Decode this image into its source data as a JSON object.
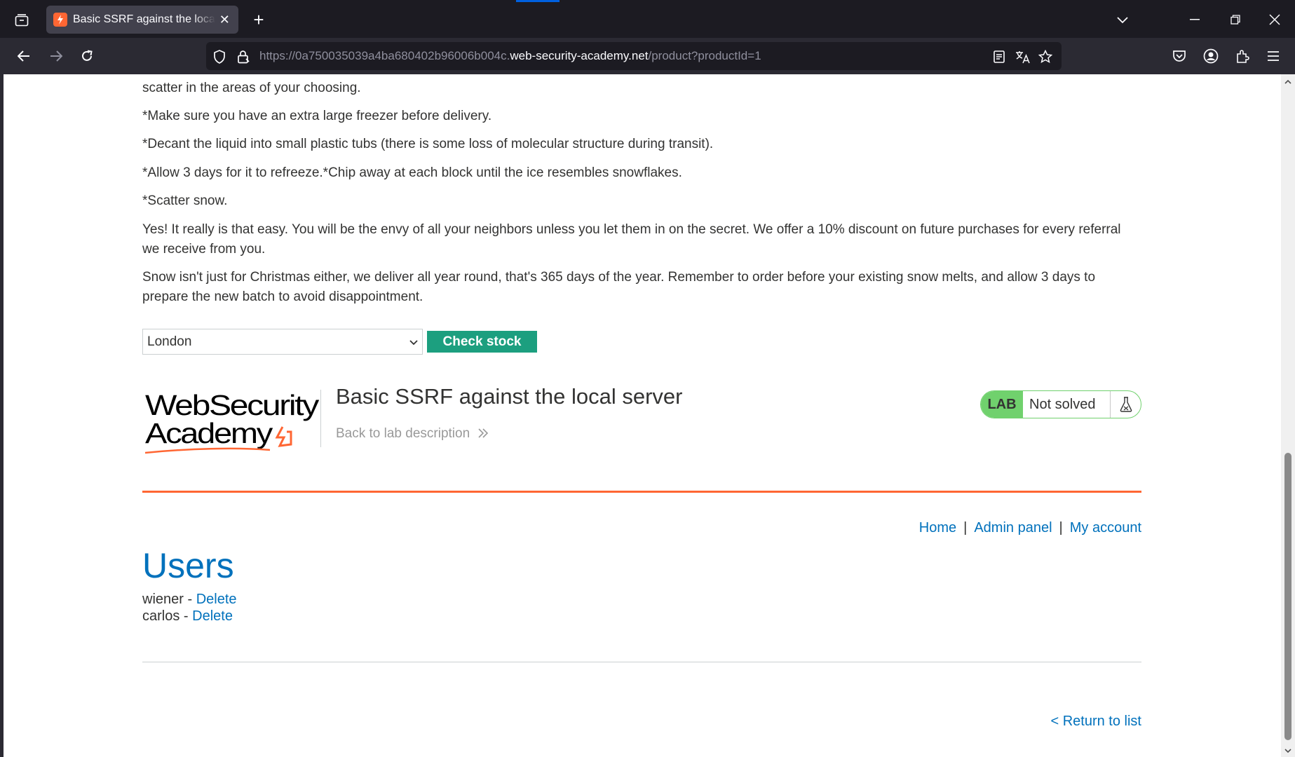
{
  "browser": {
    "tab": {
      "title": "Basic SSRF against the local server"
    },
    "url": {
      "prefix": "https://0a750035039a4ba680402b96006b004c.",
      "host": "web-security-academy.net",
      "path": "/product?productId=1"
    }
  },
  "product": {
    "paragraphs": [
      "scatter in the areas of your choosing.",
      "*Make sure you have an extra large freezer before delivery.",
      "*Decant the liquid into small plastic tubs (there is some loss of molecular structure during transit).",
      "*Allow 3 days for it to refreeze.*Chip away at each block until the ice resembles snowflakes.",
      "*Scatter snow.",
      "Yes! It really is that easy. You will be the envy of all your neighbors unless you let them in on the secret. We offer a 10% discount on future purchases for every referral we receive from you.",
      "Snow isn't just for Christmas either, we deliver all year round, that's 365 days of the year. Remember to order before your existing snow melts, and allow 3 days to prepare the new batch to avoid disappointment."
    ],
    "stock": {
      "selected_store": "London",
      "check_label": "Check stock"
    }
  },
  "lab": {
    "logo_line1": "WebSecurity",
    "logo_line2": "Academy",
    "title": "Basic SSRF against the local server",
    "back_label": "Back to lab description",
    "badge": "LAB",
    "status": "Not solved"
  },
  "nav": {
    "home": "Home",
    "separator": "|",
    "admin": "Admin panel",
    "account": "My account"
  },
  "admin": {
    "heading": "Users",
    "users": [
      {
        "name": "wiener",
        "action": "Delete"
      },
      {
        "name": "carlos",
        "action": "Delete"
      }
    ],
    "dash": " - ",
    "return_label": "< Return to list"
  },
  "colors": {
    "accent_orange": "#ff6633",
    "link_blue": "#0071bc",
    "button_green": "#1c9f7f",
    "lab_green": "#70d16d"
  }
}
